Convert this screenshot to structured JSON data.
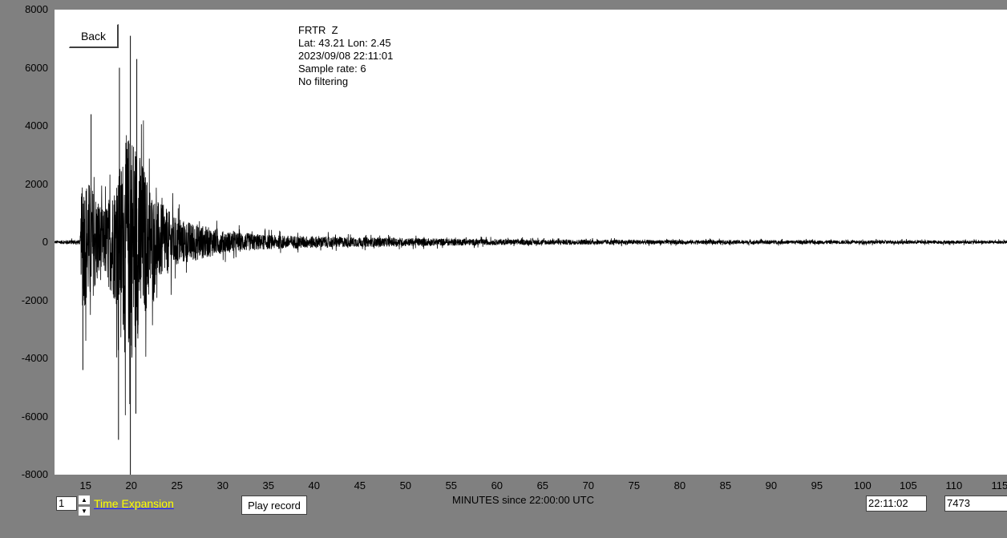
{
  "station": {
    "name": "FRTR  Z",
    "location": "Lat: 43.21 Lon: 2.45",
    "datetime": "2023/09/08 22:11:01",
    "sample_rate": "Sample rate: 6",
    "filter": "No filtering"
  },
  "controls": {
    "back_label": "Back",
    "expansion_value": "1",
    "expansion_label": "Time Expansion",
    "play_label": "Play record",
    "time_value": "22:11:02",
    "count_value": "7473"
  },
  "colors": {
    "background": "#808080",
    "plot_background": "#ffffff",
    "trace": "#000000",
    "expansion_label": "#ffff00"
  },
  "chart_data": {
    "type": "line",
    "title": "",
    "xlabel": "MINUTES since 22:00:00 UTC",
    "ylabel": "",
    "xlim": [
      11.6,
      115.8
    ],
    "ylim": [
      -8000,
      8000
    ],
    "x_ticks": [
      "15",
      "20",
      "25",
      "30",
      "35",
      "40",
      "45",
      "50",
      "55",
      "60",
      "65",
      "70",
      "75",
      "80",
      "85",
      "90",
      "95",
      "100",
      "105",
      "110",
      "115"
    ],
    "y_ticks": [
      "8000",
      "6000",
      "4000",
      "2000",
      "0",
      "-2000",
      "-4000",
      "-6000",
      "-8000"
    ],
    "grid": false,
    "series": [
      {
        "envelope": [
          {
            "x": 11.6,
            "amp": 100
          },
          {
            "x": 14.4,
            "amp": 150
          },
          {
            "x": 14.6,
            "amp": 4200
          },
          {
            "x": 15.5,
            "amp": 3800
          },
          {
            "x": 17.0,
            "amp": 2000
          },
          {
            "x": 18.5,
            "amp": 4200
          },
          {
            "x": 19.5,
            "amp": 6500
          },
          {
            "x": 20.0,
            "amp": 7500
          },
          {
            "x": 21.0,
            "amp": 5500
          },
          {
            "x": 22.5,
            "amp": 2800
          },
          {
            "x": 25.0,
            "amp": 1500
          },
          {
            "x": 30.0,
            "amp": 700
          },
          {
            "x": 35.0,
            "amp": 450
          },
          {
            "x": 45.0,
            "amp": 300
          },
          {
            "x": 60.0,
            "amp": 180
          },
          {
            "x": 80.0,
            "amp": 130
          },
          {
            "x": 115.8,
            "amp": 100
          }
        ],
        "peaks": [
          {
            "x": 15.6,
            "y": 4400
          },
          {
            "x": 14.7,
            "y": -4400
          },
          {
            "x": 18.7,
            "y": 6000
          },
          {
            "x": 18.6,
            "y": -6800
          },
          {
            "x": 19.9,
            "y": 7100
          },
          {
            "x": 19.9,
            "y": -8000
          },
          {
            "x": 20.6,
            "y": 6300
          },
          {
            "x": 20.5,
            "y": -5900
          }
        ]
      }
    ]
  }
}
